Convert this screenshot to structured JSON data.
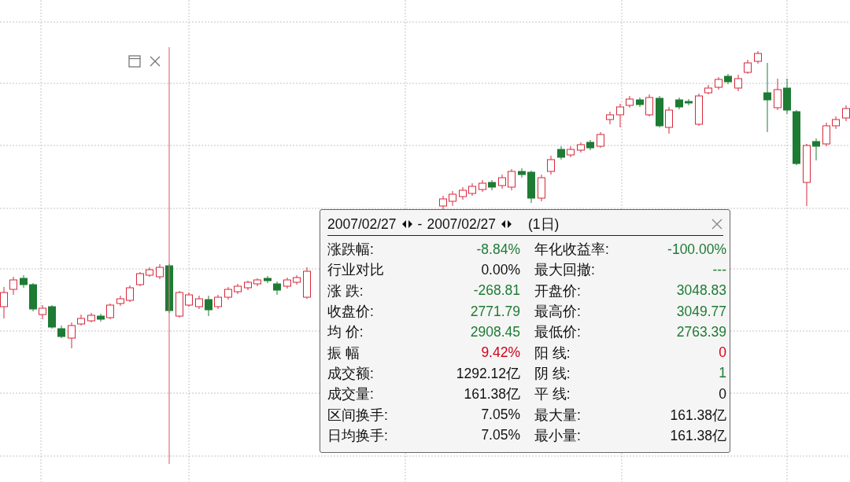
{
  "popup": {
    "start_date": "2007/02/27",
    "separator": "-",
    "end_date": "2007/02/27",
    "span": "(1日)",
    "rows": [
      {
        "left": {
          "label": "涨跌幅:",
          "value": "-8.84%",
          "color": "#1e7b34"
        },
        "right": {
          "label": "年化收益率:",
          "value": "-100.00%",
          "color": "#1e7b34"
        }
      },
      {
        "left": {
          "label": "行业对比",
          "value": "0.00%",
          "color": "#111111"
        },
        "right": {
          "label": "最大回撤:",
          "value": "---",
          "color": "#1e7b34"
        }
      },
      {
        "left": {
          "label": "涨 跌:",
          "value": "-268.81",
          "color": "#1e7b34"
        },
        "right": {
          "label": "开盘价:",
          "value": "3048.83",
          "color": "#1e7b34"
        }
      },
      {
        "left": {
          "label": "收盘价:",
          "value": "2771.79",
          "color": "#1e7b34"
        },
        "right": {
          "label": "最高价:",
          "value": "3049.77",
          "color": "#1e7b34"
        }
      },
      {
        "left": {
          "label": "均 价:",
          "value": "2908.45",
          "color": "#1e7b34"
        },
        "right": {
          "label": "最低价:",
          "value": "2763.39",
          "color": "#1e7b34"
        }
      },
      {
        "left": {
          "label": "振 幅",
          "value": "9.42%",
          "color": "#d0021b"
        },
        "right": {
          "label": "阳 线:",
          "value": "0",
          "color": "#d0021b"
        }
      },
      {
        "left": {
          "label": "成交额:",
          "value": "1292.12亿",
          "color": "#111111"
        },
        "right": {
          "label": "阴 线:",
          "value": "1",
          "color": "#1e7b34"
        }
      },
      {
        "left": {
          "label": "成交量:",
          "value": "161.38亿",
          "color": "#111111"
        },
        "right": {
          "label": "平 线:",
          "value": "0",
          "color": "#111111"
        }
      },
      {
        "left": {
          "label": "区间换手:",
          "value": "7.05%",
          "color": "#111111"
        },
        "right": {
          "label": "最大量:",
          "value": "161.38亿",
          "color": "#111111"
        }
      },
      {
        "left": {
          "label": "日均换手:",
          "value": "7.05%",
          "color": "#111111"
        },
        "right": {
          "label": "最小量:",
          "value": "161.38亿",
          "color": "#111111"
        }
      }
    ]
  }
}
